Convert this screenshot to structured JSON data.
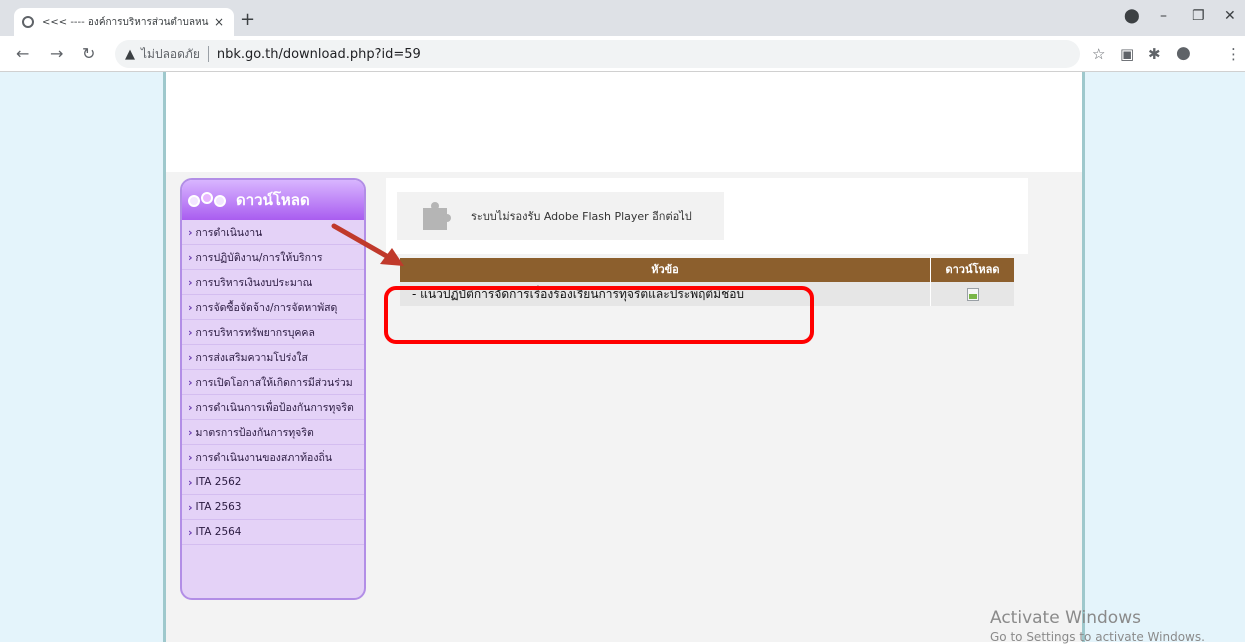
{
  "browser": {
    "tab_title": "<<< ---- องค์การบริหารส่วนตำบลหน",
    "tab_close": "×",
    "new_tab": "+",
    "not_secure_label": "ไม่ปลอดภัย",
    "url": "nbk.go.th/download.php?id=59"
  },
  "sidebar": {
    "title": "ดาวน์โหลด",
    "items": [
      {
        "label": "การดำเนินงาน"
      },
      {
        "label": "การปฏิบัติงาน/การให้บริการ"
      },
      {
        "label": "การบริหารเงินงบประมาณ"
      },
      {
        "label": "การจัดซื้อจัดจ้าง/การจัดหาพัสดุ"
      },
      {
        "label": "การบริหารทรัพยากรบุคคล"
      },
      {
        "label": "การส่งเสริมความโปร่งใส"
      },
      {
        "label": "การเปิดโอกาสให้เกิดการมีส่วนร่วม"
      },
      {
        "label": "การดำเนินการเพื่อป้องกันการทุจริต"
      },
      {
        "label": "มาตรการป้องกันการทุจริต"
      },
      {
        "label": "การดำเนินงานของสภาท้องถิ่น"
      },
      {
        "label": "ITA 2562"
      },
      {
        "label": "ITA 2563"
      },
      {
        "label": "ITA 2564"
      }
    ]
  },
  "flash_notice": "ระบบไม่รองรับ Adobe Flash Player อีกต่อไป",
  "table": {
    "headers": {
      "topic": "หัวข้อ",
      "download": "ดาวน์โหลด"
    },
    "rows": [
      {
        "topic": "- แนวปฏิบัติการจัดการเรื่องร้องเรียนการทุจริตและประพฤติมิชอบ"
      }
    ]
  },
  "watermark": {
    "line1": "Activate Windows",
    "line2": "Go to Settings to activate Windows."
  },
  "colors": {
    "table_header": "#8c5f2d",
    "sidebar_bg": "#e4d2f7",
    "highlight": "#ff0000",
    "arrow": "#c0392b"
  }
}
